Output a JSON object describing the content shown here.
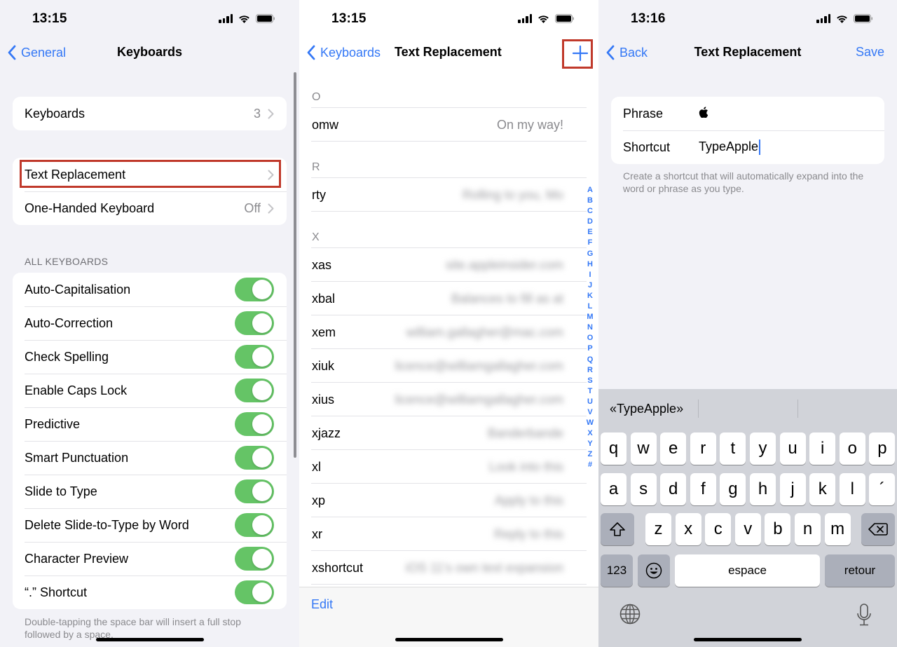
{
  "panels": {
    "keyboards_settings": {
      "status_time": "13:15",
      "nav": {
        "back_label": "General",
        "title": "Keyboards"
      },
      "group1": [
        {
          "label": "Keyboards",
          "detail": "3"
        }
      ],
      "group2": [
        {
          "label": "Text Replacement",
          "detail": "",
          "highlighted": true
        },
        {
          "label": "One-Handed Keyboard",
          "detail": "Off"
        }
      ],
      "all_keyboards_header": "ALL KEYBOARDS",
      "toggles": [
        {
          "label": "Auto-Capitalisation",
          "on": true
        },
        {
          "label": "Auto-Correction",
          "on": true
        },
        {
          "label": "Check Spelling",
          "on": true
        },
        {
          "label": "Enable Caps Lock",
          "on": true
        },
        {
          "label": "Predictive",
          "on": true
        },
        {
          "label": "Smart Punctuation",
          "on": true
        },
        {
          "label": "Slide to Type",
          "on": true
        },
        {
          "label": "Delete Slide-to-Type by Word",
          "on": true
        },
        {
          "label": "Character Preview",
          "on": true
        },
        {
          "label": "“.” Shortcut",
          "on": true
        }
      ],
      "footer_note": "Double-tapping the space bar will insert a full stop followed by a space."
    },
    "text_replacement_list": {
      "status_time": "13:15",
      "nav": {
        "back_label": "Keyboards",
        "title": "Text Replacement",
        "add_icon": "plus-icon"
      },
      "sections": [
        {
          "letter": "O",
          "rows": [
            {
              "shortcut": "omw",
              "phrase": "On my way!",
              "blurred": false
            }
          ]
        },
        {
          "letter": "R",
          "rows": [
            {
              "shortcut": "rty",
              "phrase": "Rolling to you, Mo",
              "blurred": true
            }
          ]
        },
        {
          "letter": "X",
          "rows": [
            {
              "shortcut": "xas",
              "phrase": "site.appleinsider.com",
              "blurred": true
            },
            {
              "shortcut": "xbal",
              "phrase": "Balances to fill as at",
              "blurred": true
            },
            {
              "shortcut": "xem",
              "phrase": "william.gallagher@mac.com",
              "blurred": true
            },
            {
              "shortcut": "xiuk",
              "phrase": "licence@williamgallagher.com",
              "blurred": true
            },
            {
              "shortcut": "xius",
              "phrase": "licence@williamgallagher.com",
              "blurred": true
            },
            {
              "shortcut": "xjazz",
              "phrase": "Banderbande",
              "blurred": true
            },
            {
              "shortcut": "xl",
              "phrase": "Look into this",
              "blurred": true
            },
            {
              "shortcut": "xp",
              "phrase": "Apply to this",
              "blurred": true
            },
            {
              "shortcut": "xr",
              "phrase": "Reply to this",
              "blurred": true
            },
            {
              "shortcut": "xshortcut",
              "phrase": "iOS 11's own text expansion",
              "blurred": true
            }
          ]
        }
      ],
      "index": [
        "A",
        "B",
        "C",
        "D",
        "E",
        "F",
        "G",
        "H",
        "I",
        "J",
        "K",
        "L",
        "M",
        "N",
        "O",
        "P",
        "Q",
        "R",
        "S",
        "T",
        "U",
        "V",
        "W",
        "X",
        "Y",
        "Z",
        "#"
      ],
      "toolbar": {
        "edit_label": "Edit"
      }
    },
    "new_replacement": {
      "status_time": "13:16",
      "nav": {
        "back_label": "Back",
        "title": "Text Replacement",
        "save_label": "Save"
      },
      "fields": {
        "phrase_label": "Phrase",
        "phrase_value": "",
        "shortcut_label": "Shortcut",
        "shortcut_value": "TypeApple"
      },
      "hint": "Create a shortcut that will automatically expand into the word or phrase as you type.",
      "keyboard": {
        "predictions": [
          "«TypeApple»",
          "",
          ""
        ],
        "row1": [
          "q",
          "w",
          "e",
          "r",
          "t",
          "y",
          "u",
          "i",
          "o",
          "p"
        ],
        "row2": [
          "a",
          "s",
          "d",
          "f",
          "g",
          "h",
          "j",
          "k",
          "l",
          "´"
        ],
        "row3": [
          "z",
          "x",
          "c",
          "v",
          "b",
          "n",
          "m"
        ],
        "numbers_label": "123",
        "space_label": "espace",
        "return_label": "retour"
      }
    }
  },
  "colors": {
    "accent": "#3478f6",
    "toggle_on": "#65c466",
    "highlight_box": "#c0392b"
  }
}
